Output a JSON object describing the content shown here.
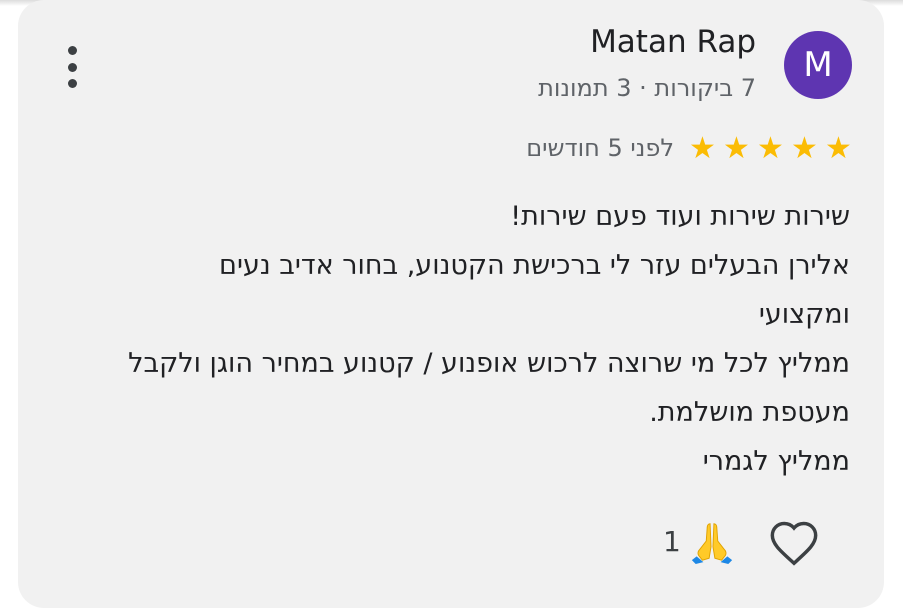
{
  "review": {
    "author": {
      "name": "Matan Rap",
      "initial": "M",
      "avatar_color": "#5e35b1",
      "meta": "7 ביקורות · 3 תמונות"
    },
    "rating": 5,
    "rating_max": 5,
    "star_color": "#fbbc04",
    "time": "לפני 5 חודשים",
    "text_lines": [
      "שירות שירות ועוד פעם שירות!",
      "אלירן הבעלים עזר לי ברכישת הקטנוע, בחור אדיב נעים",
      "ומקצועי",
      "ממליץ לכל מי שרוצה לרכוש אופנוע / קטנוע במחיר הוגן ולקבל",
      "מעטפת מושלמת.",
      "ממליץ לגמרי"
    ],
    "reactions": {
      "emoji": "pray-icon",
      "count": "1"
    },
    "actions": {
      "like_icon": "heart-outline-icon",
      "more_icon": "more-vert-icon"
    }
  }
}
